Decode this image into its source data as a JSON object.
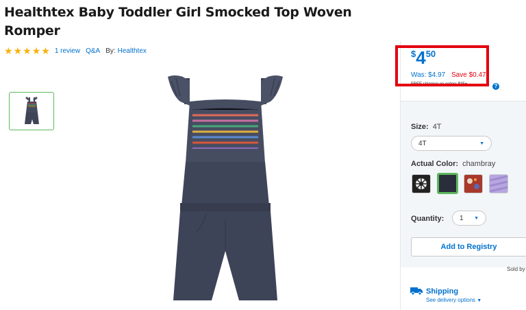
{
  "product": {
    "title": "Healthtex Baby Toddler Girl Smocked Top Woven Romper"
  },
  "rating": {
    "stars": 5,
    "reviews_link": "1 review",
    "qa_link": "Q&A",
    "by_label": "By:",
    "brand_link": "Healthtex"
  },
  "price": {
    "currency": "$",
    "dollars": "4",
    "cents": "50",
    "was": "Was: $4.97",
    "save": "Save $0.47",
    "shipping_text": "FREE shipping on orders $35+"
  },
  "size": {
    "label": "Size:",
    "value": "4T",
    "selected": "4T"
  },
  "color": {
    "label": "Actual Color:",
    "value": "chambray",
    "swatches": [
      "floral-print",
      "chambray",
      "red-print",
      "lavender-print"
    ]
  },
  "quantity": {
    "label": "Quantity:",
    "selected": "1"
  },
  "actions": {
    "registry": "Add to Registry",
    "sold_by": "Sold by"
  },
  "shipping": {
    "title": "Shipping",
    "options_link": "See delivery options"
  },
  "colors": {
    "accent_blue": "#0071ce",
    "sale_red": "#e3000f",
    "star_yellow": "#f9b20c",
    "selected_green": "#5cb85c",
    "highlight_box": "#e3000f"
  }
}
